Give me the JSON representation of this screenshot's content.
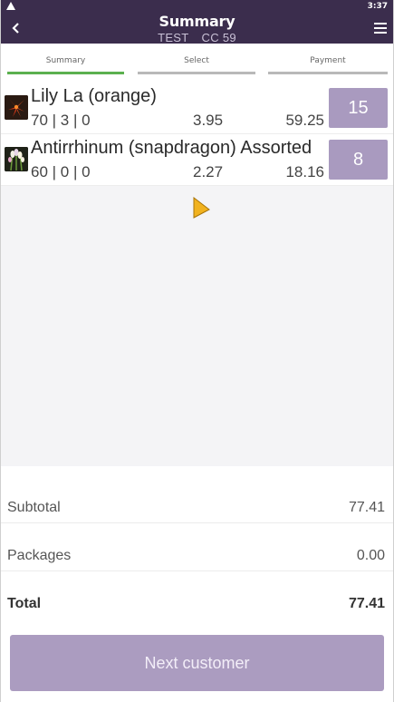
{
  "status": {
    "time": "3:37",
    "warning_icon": "warning-icon"
  },
  "header": {
    "title": "Summary",
    "subtitle_left": "TEST",
    "subtitle_right": "CC 59",
    "back_icon": "chevron-left-icon",
    "menu_icon": "hamburger-menu-icon"
  },
  "tabs": [
    {
      "label": "Summary",
      "active": true
    },
    {
      "label": "Select",
      "active": false
    },
    {
      "label": "Payment",
      "active": false
    }
  ],
  "items": [
    {
      "name": "Lily La (orange)",
      "counts": "70 | 3 | 0",
      "price": "3.95",
      "total": "59.25",
      "qty": "15"
    },
    {
      "name": "Antirrhinum (snapdragon) Assorted",
      "counts": "60 | 0 | 0",
      "price": "2.27",
      "total": "18.16",
      "qty": "8"
    }
  ],
  "totals": {
    "subtotal_label": "Subtotal",
    "subtotal_value": "77.41",
    "packages_label": "Packages",
    "packages_value": "0.00",
    "total_label": "Total",
    "total_value": "77.41"
  },
  "actions": {
    "next_label": "Next customer"
  },
  "colors": {
    "header_bg": "#3b2d4d",
    "accent": "#a99abf",
    "active_tab": "#5bb04f"
  }
}
